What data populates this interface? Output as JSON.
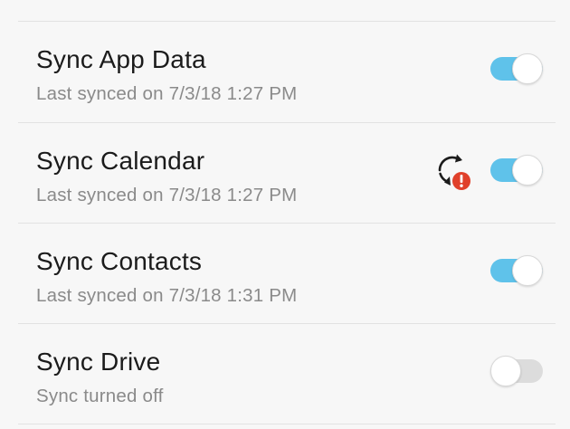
{
  "sync_items": [
    {
      "title": "Sync App Data",
      "subtitle": "Last synced on 7/3/18  1:27 PM",
      "enabled": true
    },
    {
      "title": "Sync Calendar",
      "subtitle": "Last synced on 7/3/18  1:27 PM",
      "enabled": true,
      "status_icon": "sync-error-icon"
    },
    {
      "title": "Sync Contacts",
      "subtitle": "Last synced on 7/3/18  1:31 PM",
      "enabled": true
    },
    {
      "title": "Sync Drive",
      "subtitle": "Sync turned off",
      "enabled": false
    }
  ],
  "colors": {
    "toggle_on": "#5fc2ea",
    "toggle_off": "#dcdcdc",
    "error_badge": "#e0402a",
    "title_text": "#1b1b1b",
    "subtitle_text": "#8a8a8a"
  }
}
